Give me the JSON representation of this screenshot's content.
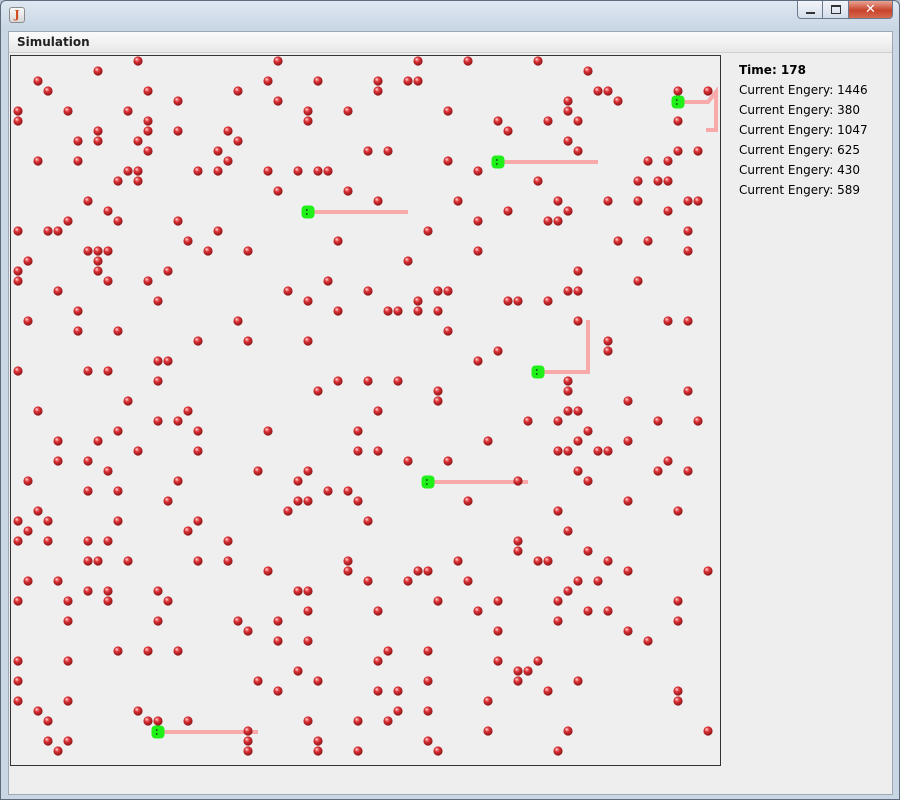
{
  "window": {
    "title": "Simulation",
    "controls": {
      "minimize_icon": "minimize-icon",
      "maximize_icon": "maximize-icon",
      "close_icon": "close-icon",
      "close_glyph": "✕"
    }
  },
  "menubar": {
    "items": [
      {
        "label": "Simulation"
      }
    ]
  },
  "status": {
    "time_label": "Time: 178",
    "energies": [
      "Current Engery: 1446",
      "Current Engery: 380",
      "Current Engery: 1047",
      "Current Engery: 625",
      "Current Engery: 430",
      "Current Engery: 589"
    ]
  },
  "colors": {
    "food": "#c8262a",
    "agent": "#1ef018",
    "trail": "#f7aaa9",
    "canvas_bg": "#efefef"
  },
  "icons": {
    "food": "food-dot-icon",
    "agent": "agent-icon",
    "app": "java-app-icon"
  }
}
